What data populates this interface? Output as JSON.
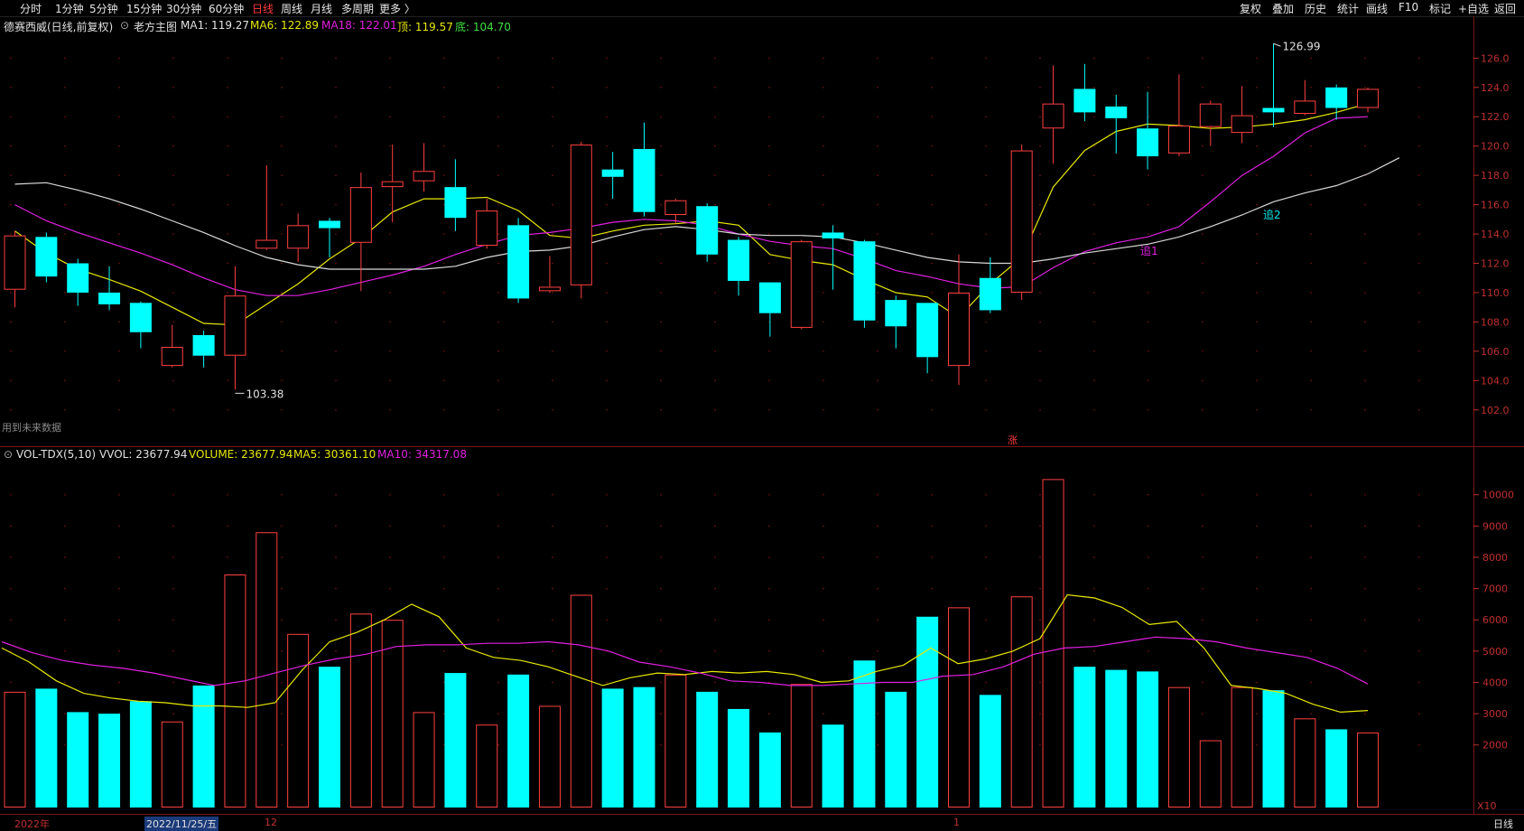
{
  "toolbar": {
    "left": [
      "分时",
      "1分钟",
      "5分钟",
      "15分钟",
      "30分钟",
      "60分钟",
      "日线",
      "周线",
      "月线",
      "多周期",
      "更多 〉"
    ],
    "active": "日线",
    "right": [
      "复权",
      "叠加",
      "历史",
      "统计",
      "画线",
      "F10",
      "标记",
      "+自选",
      "返回"
    ]
  },
  "info": {
    "stock": "德赛西威(日线,前复权)",
    "indicator": "老方主图",
    "ma1": "MA1: 119.27",
    "ma6": "MA6: 122.89",
    "ma18": "MA18: 122.01",
    "top": "顶: 119.57",
    "bottom": "底: 104.70"
  },
  "vol_info": {
    "name": "VOL-TDX(5,10)",
    "vvol": "VVOL: 23677.94",
    "volume": "VOLUME: 23677.94",
    "ma5": "MA5: 30361.10",
    "ma10": "MA10: 34317.08"
  },
  "notes": {
    "future_data": "用到未来数据",
    "zhang": "涨",
    "chase1": "追1",
    "chase2": "追2",
    "max_label": "126.99",
    "min_label": "103.38",
    "vol_unit": "X10"
  },
  "bottom": {
    "year": "2022年",
    "date": "2022/11/25/五",
    "month12": "12",
    "month1": "1",
    "period": "日线"
  },
  "colors": {
    "up": "#ff4040",
    "down": "#00ffff",
    "ma1": "#e8e800",
    "ma6": "#e020e0",
    "ma18": "#d8d8d8",
    "vol_ma5": "#e8e800",
    "vol_ma10": "#e020e0"
  },
  "chart_data": [
    {
      "type": "candlestick",
      "title": "德赛西威(日线,前复权)",
      "ylim": [
        101,
        127.5
      ],
      "y_ticks": [
        102,
        104,
        106,
        108,
        110,
        112,
        114,
        116,
        118,
        120,
        122,
        124,
        126
      ],
      "candles": [
        {
          "o": 110.2,
          "h": 114.2,
          "l": 109.0,
          "c": 113.9
        },
        {
          "o": 113.8,
          "h": 114.1,
          "l": 110.7,
          "c": 111.1
        },
        {
          "o": 112.0,
          "h": 112.3,
          "l": 109.1,
          "c": 110.0
        },
        {
          "o": 110.0,
          "h": 111.8,
          "l": 108.8,
          "c": 109.2
        },
        {
          "o": 109.3,
          "h": 109.4,
          "l": 106.2,
          "c": 107.3
        },
        {
          "o": 105.0,
          "h": 107.8,
          "l": 104.9,
          "c": 106.3
        },
        {
          "o": 107.1,
          "h": 107.4,
          "l": 104.9,
          "c": 105.7
        },
        {
          "o": 105.7,
          "h": 111.8,
          "l": 103.38,
          "c": 109.8
        },
        {
          "o": 113.0,
          "h": 118.7,
          "l": 112.9,
          "c": 113.6
        },
        {
          "o": 113.0,
          "h": 115.4,
          "l": 112.1,
          "c": 114.6
        },
        {
          "o": 114.9,
          "h": 115.1,
          "l": 112.4,
          "c": 114.4
        },
        {
          "o": 113.4,
          "h": 118.2,
          "l": 110.1,
          "c": 117.2
        },
        {
          "o": 117.2,
          "h": 120.1,
          "l": 114.8,
          "c": 117.6
        },
        {
          "o": 117.6,
          "h": 120.2,
          "l": 116.9,
          "c": 118.3
        },
        {
          "o": 117.2,
          "h": 119.1,
          "l": 114.2,
          "c": 115.1
        },
        {
          "o": 113.2,
          "h": 116.4,
          "l": 113.0,
          "c": 115.6
        },
        {
          "o": 114.6,
          "h": 115.1,
          "l": 109.3,
          "c": 109.6
        },
        {
          "o": 110.1,
          "h": 112.5,
          "l": 110.0,
          "c": 110.4
        },
        {
          "o": 110.5,
          "h": 120.3,
          "l": 109.6,
          "c": 120.1
        },
        {
          "o": 118.4,
          "h": 119.6,
          "l": 116.4,
          "c": 117.9
        },
        {
          "o": 119.8,
          "h": 121.6,
          "l": 115.2,
          "c": 115.5
        },
        {
          "o": 115.3,
          "h": 116.4,
          "l": 114.7,
          "c": 116.3
        },
        {
          "o": 115.9,
          "h": 116.1,
          "l": 112.1,
          "c": 112.6
        },
        {
          "o": 113.6,
          "h": 113.8,
          "l": 109.8,
          "c": 110.8
        },
        {
          "o": 110.7,
          "h": 110.7,
          "l": 107.0,
          "c": 108.6
        },
        {
          "o": 107.6,
          "h": 113.6,
          "l": 107.5,
          "c": 113.5
        },
        {
          "o": 114.1,
          "h": 114.6,
          "l": 110.2,
          "c": 113.7
        },
        {
          "o": 113.5,
          "h": 113.6,
          "l": 107.6,
          "c": 108.1
        },
        {
          "o": 109.5,
          "h": 109.8,
          "l": 106.2,
          "c": 107.7
        },
        {
          "o": 109.3,
          "h": 109.3,
          "l": 104.5,
          "c": 105.6
        },
        {
          "o": 105.0,
          "h": 112.6,
          "l": 103.7,
          "c": 110.0
        },
        {
          "o": 111.0,
          "h": 112.4,
          "l": 108.6,
          "c": 108.8
        },
        {
          "o": 110.0,
          "h": 120.1,
          "l": 109.5,
          "c": 119.7
        },
        {
          "o": 121.2,
          "h": 125.5,
          "l": 118.8,
          "c": 122.9
        },
        {
          "o": 123.9,
          "h": 125.6,
          "l": 121.7,
          "c": 122.3
        },
        {
          "o": 122.7,
          "h": 123.5,
          "l": 119.5,
          "c": 121.9
        },
        {
          "o": 121.2,
          "h": 123.7,
          "l": 118.4,
          "c": 119.3
        },
        {
          "o": 119.5,
          "h": 124.9,
          "l": 119.3,
          "c": 121.4
        },
        {
          "o": 121.3,
          "h": 123.1,
          "l": 120.0,
          "c": 122.9
        },
        {
          "o": 120.9,
          "h": 124.1,
          "l": 120.2,
          "c": 122.1
        },
        {
          "o": 122.6,
          "h": 126.99,
          "l": 121.3,
          "c": 122.3
        },
        {
          "o": 122.2,
          "h": 124.5,
          "l": 122.1,
          "c": 123.1
        },
        {
          "o": 124.0,
          "h": 124.2,
          "l": 121.8,
          "c": 122.6
        },
        {
          "o": 122.6,
          "h": 124.0,
          "l": 122.3,
          "c": 123.9
        }
      ],
      "series": [
        {
          "name": "MA1",
          "values": [
            114.2,
            112.7,
            111.6,
            110.9,
            110.1,
            109.0,
            107.9,
            107.8,
            109.2,
            110.6,
            112.3,
            113.7,
            115.5,
            116.4,
            116.4,
            116.5,
            115.6,
            113.9,
            113.7,
            114.2,
            114.6,
            114.7,
            114.9,
            114.6,
            112.6,
            112.2,
            111.9,
            110.9,
            110.0,
            109.7,
            108.3,
            110.6,
            112.4,
            117.2,
            119.7,
            121.0,
            121.5,
            121.4,
            121.2,
            121.3,
            121.5,
            121.8,
            122.3,
            122.9
          ]
        },
        {
          "name": "MA6",
          "values": [
            116.0,
            114.9,
            114.1,
            113.4,
            112.7,
            111.9,
            111.0,
            110.2,
            109.8,
            109.8,
            110.2,
            110.7,
            111.2,
            111.8,
            112.6,
            113.3,
            113.9,
            114.1,
            114.4,
            114.8,
            115.0,
            114.9,
            114.6,
            114.0,
            113.5,
            113.2,
            113.0,
            112.3,
            111.5,
            111.1,
            110.6,
            110.3,
            110.4,
            111.7,
            112.8,
            113.4,
            113.8,
            114.5,
            116.2,
            118.0,
            119.3,
            120.9,
            121.9,
            122.0
          ]
        },
        {
          "name": "MA18",
          "values": [
            117.4,
            117.5,
            117.0,
            116.4,
            115.7,
            114.9,
            114.1,
            113.2,
            112.4,
            111.9,
            111.6,
            111.6,
            111.6,
            111.6,
            111.8,
            112.4,
            112.8,
            112.9,
            113.2,
            113.8,
            114.3,
            114.5,
            114.3,
            114.0,
            113.9,
            113.9,
            113.8,
            113.4,
            112.9,
            112.4,
            112.1,
            112.0,
            112.0,
            112.3,
            112.7,
            113.0,
            113.3,
            113.8,
            114.5,
            115.3,
            116.2,
            116.8,
            117.3,
            118.1,
            119.2
          ]
        }
      ],
      "markers": [
        "追1",
        "追2",
        "涨"
      ]
    },
    {
      "type": "bar",
      "title": "VOL-TDX(5,10)",
      "ylabel": "X10",
      "ylim": [
        0,
        10800
      ],
      "y_ticks": [
        2000,
        3000,
        4000,
        5000,
        6000,
        7000,
        8000,
        9000,
        10000
      ],
      "values": [
        3700,
        3800,
        3050,
        3000,
        3400,
        2750,
        3900,
        7450,
        8800,
        5550,
        4500,
        6200,
        6000,
        3050,
        4300,
        2650,
        4250,
        3250,
        6800,
        3800,
        3850,
        4250,
        3700,
        3150,
        2400,
        3950,
        2650,
        4700,
        3700,
        6100,
        6400,
        3600,
        6750,
        10500,
        4500,
        4400,
        4350,
        3850,
        2150,
        3850,
        3750,
        2850,
        2500,
        2400
      ],
      "series": [
        {
          "name": "MA5",
          "values": [
            5100,
            4650,
            4050,
            3650,
            3500,
            3400,
            3350,
            3250,
            3250,
            3200,
            3350,
            4400,
            5300,
            5600,
            6000,
            6500,
            6100,
            5100,
            4800,
            4700,
            4500,
            4200,
            3900,
            4150,
            4300,
            4250,
            4350,
            4300,
            4350,
            4250,
            4000,
            4050,
            4350,
            4550,
            5100,
            4600,
            4750,
            5000,
            5400,
            6800,
            6700,
            6400,
            5850,
            5950,
            5100,
            3900,
            3800,
            3650,
            3300,
            3050,
            3100
          ]
        },
        {
          "name": "MA10",
          "values": [
            5300,
            4950,
            4700,
            4550,
            4450,
            4300,
            4100,
            3900,
            4050,
            4300,
            4550,
            4750,
            4900,
            5150,
            5200,
            5200,
            5250,
            5250,
            5300,
            5200,
            5000,
            4650,
            4500,
            4300,
            4050,
            4000,
            3900,
            3900,
            3950,
            4000,
            4000,
            4200,
            4250,
            4500,
            4900,
            5100,
            5150,
            5300,
            5450,
            5400,
            5300,
            5100,
            4950,
            4800,
            4450,
            3950
          ]
        }
      ]
    }
  ]
}
